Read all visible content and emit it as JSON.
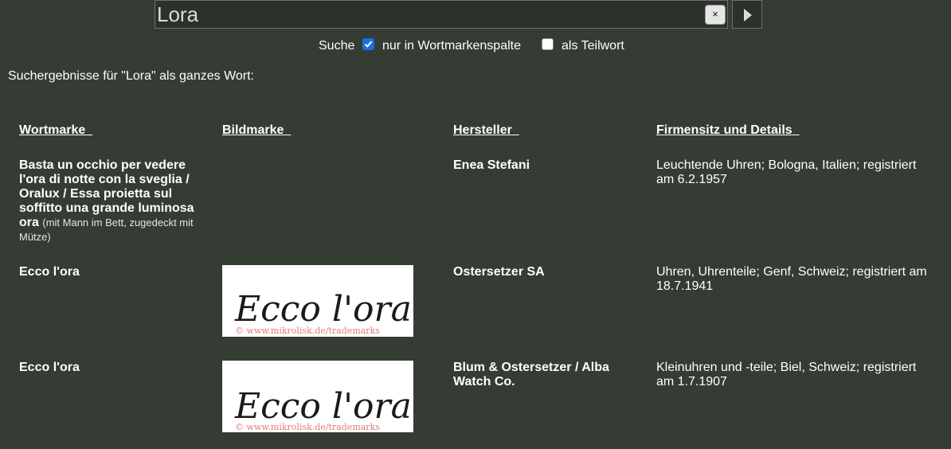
{
  "search": {
    "value": "Lora",
    "clear_label": "×",
    "go_icon": "play-triangle-icon"
  },
  "options": {
    "suche_label": "Suche",
    "wortmarken_checked": true,
    "wortmarken_label": "nur in Wortmarkenspalte",
    "teilwort_checked": false,
    "teilwort_label": "als Teilwort"
  },
  "result_summary": "Suchergebnisse für \"Lora\" als ganzes Wort:",
  "table": {
    "headers": [
      "Wortmarke",
      "Bildmarke",
      "Hersteller",
      "Firmensitz und Details"
    ],
    "rows": [
      {
        "wortmarke": "Basta un occhio per vedere l'ora di notte con la sveglia / Oralux / Essa proietta sul soffitto una grande luminosa ora",
        "wortmarke_note": "(mit Mann im Bett, zugedeckt mit Mütze)",
        "bildmarke": "",
        "hersteller": "Enea Stefani",
        "details": "Leuchtende Uhren; Bologna, Italien; registriert am 6.2.1957"
      },
      {
        "wortmarke": "Ecco l'ora",
        "bildmarke": "Ecco l'ora",
        "bildmarke_watermark": "© www.mikrolisk.de/trademarks",
        "hersteller": "Ostersetzer SA",
        "details": "Uhren, Uhrenteile; Genf, Schweiz; registriert am 18.7.1941"
      },
      {
        "wortmarke": "Ecco l'ora",
        "bildmarke": "Ecco l'ora",
        "bildmarke_watermark": "© www.mikrolisk.de/trademarks",
        "hersteller": "Blum & Ostersetzer / Alba Watch Co.",
        "details": "Kleinuhren und -teile; Biel, Schweiz; registriert am 1.7.1907"
      }
    ]
  },
  "colors": {
    "background": "#343c34",
    "checkbox_accent": "#1a6fe0",
    "watermark": "#e07a7a"
  }
}
